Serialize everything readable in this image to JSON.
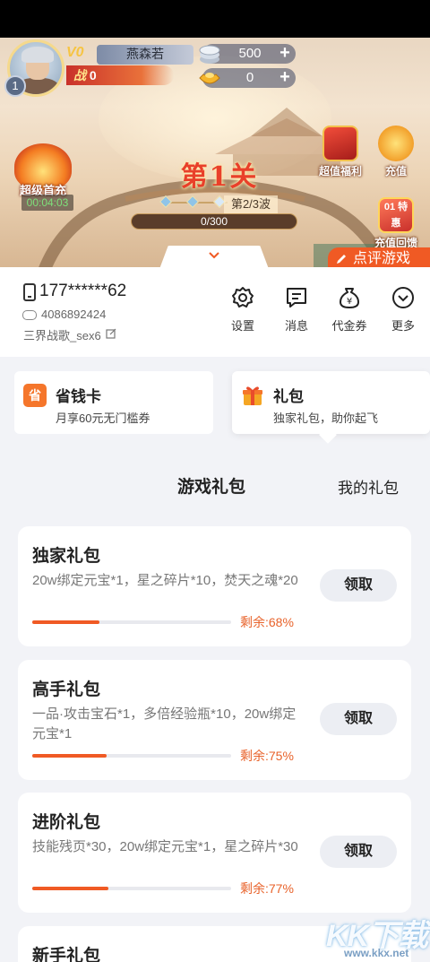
{
  "banner": {
    "player_name": "燕森若",
    "vip": "V0",
    "power_label": "战",
    "power_value": "0",
    "level": "1",
    "silver": "500",
    "gold": "0",
    "plus": "+",
    "welfare_label": "超值福利",
    "recharge_label": "充值",
    "rebate_badge": "01 特惠",
    "rebate_label": "充值回馈",
    "first_charge_label": "超级首充",
    "timer": "00:04:03",
    "stage_title": "第1关",
    "wave": "第2/3波",
    "progress": "0/300",
    "rate_game": "点评游戏"
  },
  "user": {
    "phone": "177******62",
    "uid": "4086892424",
    "server": "三界战歌_sex6",
    "quick": {
      "settings": "设置",
      "messages": "消息",
      "voucher": "代金券",
      "more": "更多"
    }
  },
  "cards": {
    "save": {
      "icon_glyph": "省",
      "title": "省钱卡",
      "subtitle": "月享60元无门槛券"
    },
    "gift": {
      "title": "礼包",
      "subtitle": "独家礼包，助你起飞"
    }
  },
  "tabs": {
    "game_gifts": "游戏礼包",
    "my_gifts": "我的礼包"
  },
  "gifts": [
    {
      "title": "独家礼包",
      "desc": "20w绑定元宝*1，星之碎片*10，焚天之魂*20",
      "claim": "领取",
      "remain": "剩余:68%",
      "remain_fraction": 0.68
    },
    {
      "title": "高手礼包",
      "desc": "一品·攻击宝石*1，多倍经验瓶*10，20w绑定元宝*1",
      "claim": "领取",
      "remain": "剩余:75%",
      "remain_fraction": 0.75
    },
    {
      "title": "进阶礼包",
      "desc": "技能残页*30，20w绑定元宝*1，星之碎片*30",
      "claim": "领取",
      "remain": "剩余:77%",
      "remain_fraction": 0.77
    },
    {
      "title": "新手礼包"
    }
  ],
  "watermark": {
    "big": "KK下载",
    "small": "www.kkx.net"
  },
  "colors": {
    "accent": "#f05a24",
    "background": "#f2f3f7"
  }
}
